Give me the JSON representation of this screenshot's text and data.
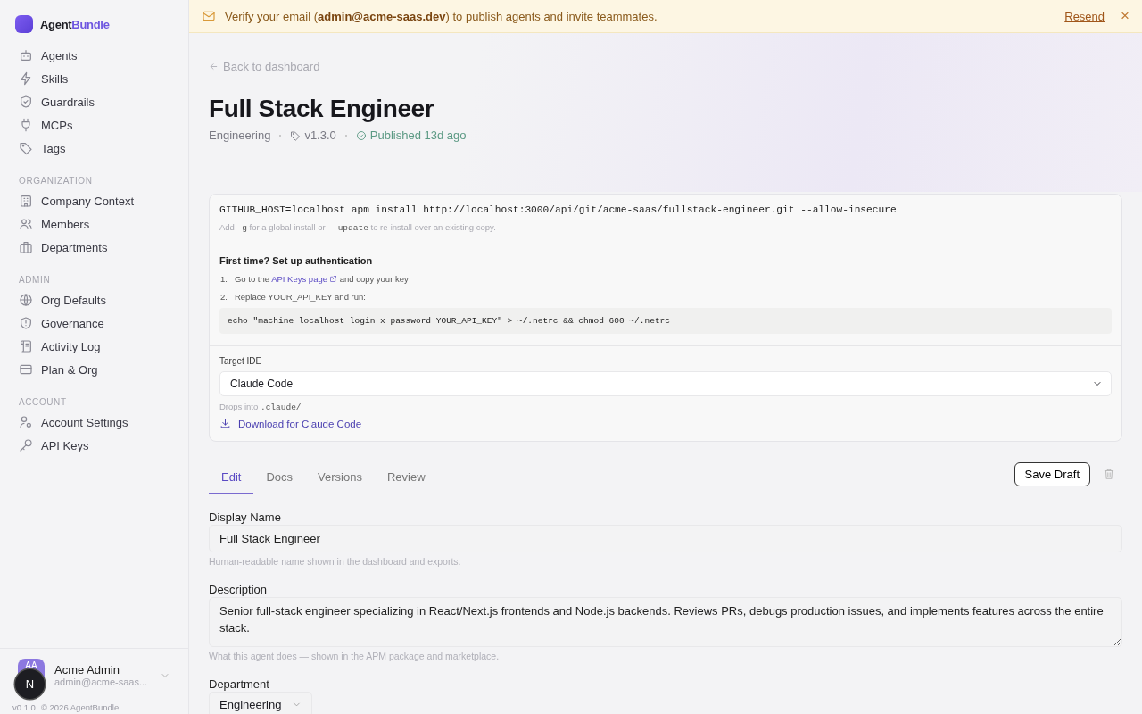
{
  "sidebar": {
    "brand": {
      "first": "Agent",
      "second": "Bundle"
    },
    "sections": [
      {
        "items": [
          {
            "label": "Agents"
          },
          {
            "label": "Skills"
          },
          {
            "label": "Guardrails"
          },
          {
            "label": "MCPs"
          },
          {
            "label": "Tags"
          }
        ]
      },
      {
        "heading": "ORGANIZATION",
        "items": [
          {
            "label": "Company Context"
          },
          {
            "label": "Members"
          },
          {
            "label": "Departments"
          }
        ]
      },
      {
        "heading": "ADMIN",
        "items": [
          {
            "label": "Org Defaults"
          },
          {
            "label": "Governance"
          },
          {
            "label": "Activity Log"
          },
          {
            "label": "Plan & Org"
          }
        ]
      },
      {
        "heading": "ACCOUNT",
        "items": [
          {
            "label": "Account Settings"
          },
          {
            "label": "API Keys"
          }
        ]
      }
    ],
    "user": {
      "initials": "AA",
      "name": "Acme Admin",
      "email": "admin@acme-saas..."
    },
    "dev_badge": "N",
    "version": "v0.1.0",
    "copyright": "© 2026 AgentBundle"
  },
  "banner": {
    "message": "Verify your email (**admin@acme-saas.dev**) to publish agents and invite teammates.",
    "action": "Resend",
    "close": "×"
  },
  "header": {
    "back": "Back to dashboard",
    "title": "Full Stack Engineer",
    "department": "Engineering",
    "version": "v1.3.0",
    "status": "Published 13d ago"
  },
  "install": {
    "command": "GITHUB_HOST=localhost apm install http://localhost:3000/api/git/acme-saas/fullstack-engineer.git --allow-insecure",
    "hint_parts": [
      {
        "kind": "text",
        "text": "Add "
      },
      {
        "kind": "code",
        "text": "-g"
      },
      {
        "kind": "text",
        "text": " for a global install or "
      },
      {
        "kind": "code",
        "text": "--update"
      },
      {
        "kind": "text",
        "text": " to re-install over an existing copy."
      }
    ],
    "auth_title": "First time? Set up authentication",
    "steps": [
      {
        "number": "1.",
        "parts": [
          {
            "kind": "text",
            "text": "Go to the "
          },
          {
            "kind": "link",
            "text": "API Keys page"
          },
          {
            "kind": "text",
            "text": " and copy your key"
          }
        ]
      },
      {
        "number": "2.",
        "parts": [
          {
            "kind": "text",
            "text": "Replace YOUR_API_KEY and run:"
          }
        ]
      }
    ],
    "auth_command": "echo \"machine localhost login x password YOUR_API_KEY\" > ~/.netrc && chmod 600 ~/.netrc",
    "ide_label": "Target IDE",
    "ide_value": "Claude Code",
    "ide_hint_parts": [
      {
        "kind": "text",
        "text": "Drops into "
      },
      {
        "kind": "code",
        "text": ".claude/"
      }
    ],
    "download": "Download for Claude Code"
  },
  "tabs": [
    {
      "label": "Edit",
      "selected": true
    },
    {
      "label": "Docs",
      "selected": false
    },
    {
      "label": "Versions",
      "selected": false
    },
    {
      "label": "Review",
      "selected": false
    }
  ],
  "save_button": "Save Draft",
  "fields": [
    {
      "kind": "input",
      "label": "Display Name",
      "value": "Full Stack Engineer",
      "hint": "Human-readable name shown in the dashboard and exports."
    },
    {
      "kind": "textarea",
      "label": "Description",
      "value": "Senior full-stack engineer specializing in React/Next.js frontends and Node.js backends. Reviews PRs, debugs production issues, and implements features across the entire stack.",
      "hint": "What this agent does — shown in the APM package and marketplace."
    },
    {
      "kind": "select",
      "label": "Department",
      "value": "Engineering"
    }
  ]
}
